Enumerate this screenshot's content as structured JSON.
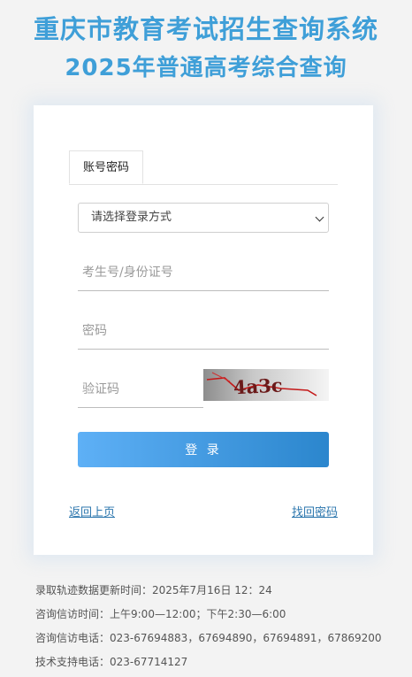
{
  "header": {
    "title": "重庆市教育考试招生查询系统",
    "subtitle": "2025年普通高考综合查询"
  },
  "login_card": {
    "tab_label": "账号密码",
    "login_method_select": "请选择登录方式",
    "username_placeholder": "考生号/身份证号",
    "password_placeholder": "密码",
    "captcha_placeholder": "验证码",
    "captcha_text": "4a3c",
    "login_button": "登 录",
    "back_link": "返回上页",
    "forgot_link": "找回密码"
  },
  "footer": {
    "update_time": "录取轨迹数据更新时间：2025年7月16日 12：24",
    "consult_time": "咨询信访时间：上午9:00—12:00；下午2:30—6:00",
    "consult_phone": "咨询信访电话：023-67694883，67694890，67694891，67869200",
    "support_phone": "技术支持电话：023-67714127"
  },
  "colors": {
    "title": "#3f9fd8",
    "button_start": "#5eb0f6",
    "button_end": "#2b86cd",
    "link": "#2d77ae",
    "background": "#f3f3f3"
  }
}
